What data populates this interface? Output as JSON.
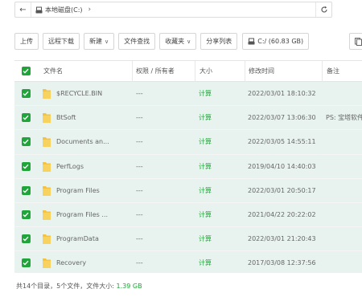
{
  "address": {
    "path": "本地磁盘(C:)"
  },
  "toolbar": {
    "upload": "上传",
    "remote_download": "远程下载",
    "new": "新建",
    "file_search": "文件查找",
    "favorites": "收藏夹",
    "share_list": "分享列表",
    "disk": "C:/ (60.83 GB)"
  },
  "table": {
    "headers": {
      "name": "文件名",
      "perm": "权限 / 所有者",
      "size": "大小",
      "time": "修改时间",
      "note": "备注"
    },
    "rows": [
      {
        "name": "$RECYCLE.BIN",
        "perm": "---",
        "size": "计算",
        "time": "2022/03/01 18:10:32",
        "note": ""
      },
      {
        "name": "BtSoft",
        "perm": "---",
        "size": "计算",
        "time": "2022/03/07 13:06:30",
        "note": "PS: 宝塔软件安装"
      },
      {
        "name": "Documents an...",
        "perm": "---",
        "size": "计算",
        "time": "2022/03/05 14:55:11",
        "note": ""
      },
      {
        "name": "PerfLogs",
        "perm": "---",
        "size": "计算",
        "time": "2019/04/10 14:40:03",
        "note": ""
      },
      {
        "name": "Program Files",
        "perm": "---",
        "size": "计算",
        "time": "2022/03/01 20:50:17",
        "note": ""
      },
      {
        "name": "Program Files ...",
        "perm": "---",
        "size": "计算",
        "time": "2021/04/22 20:22:02",
        "note": ""
      },
      {
        "name": "ProgramData",
        "perm": "---",
        "size": "计算",
        "time": "2022/03/01 21:20:43",
        "note": ""
      },
      {
        "name": "Recovery",
        "perm": "---",
        "size": "计算",
        "time": "2017/03/08 12:37:56",
        "note": ""
      }
    ]
  },
  "footer": {
    "summary": "共14个目录，5个文件，文件大小: ",
    "total_size": "1.39 GB"
  },
  "colors": {
    "accent": "#20a53a",
    "row_selected": "#e8f3ef",
    "folder": "#f5c342"
  }
}
